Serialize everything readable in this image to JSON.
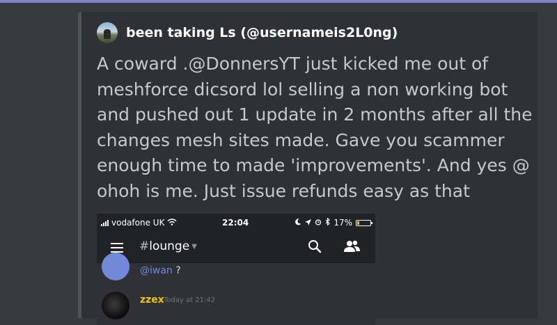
{
  "colors": {
    "background": "#36393f",
    "embed_background": "#2f3136",
    "embed_border": "#4f545c",
    "top_accent": "#7f83c7",
    "mention": "#7289da",
    "username_gold": "#f1c40f"
  },
  "embed": {
    "author_name": "been taking Ls (@usernameis2L0ng)",
    "description_lines": [
      "A coward .@DonnersYT just kicked me out of",
      "meshforce dicsord lol selling a non working bot",
      "and pushed out 1 update in 2 months after all the",
      "changes mesh sites made. Gave you scammer",
      "enough time to made 'improvements'. And yes @",
      "ohoh is me. Just issue refunds easy as that"
    ]
  },
  "phone": {
    "status": {
      "carrier": "vodafone UK",
      "time": "22:04",
      "battery": "17%",
      "battery_level": 0.17
    },
    "toolbar": {
      "channel": "lounge",
      "hash": "#",
      "menu_icon": "hamburger-icon",
      "search_icon": "search-icon",
      "members_icon": "members-icon"
    },
    "message1": {
      "mention": "@iwan",
      "after": " ?"
    },
    "message2": {
      "username": "zzex",
      "timestamp": "Today at 21:42"
    }
  }
}
